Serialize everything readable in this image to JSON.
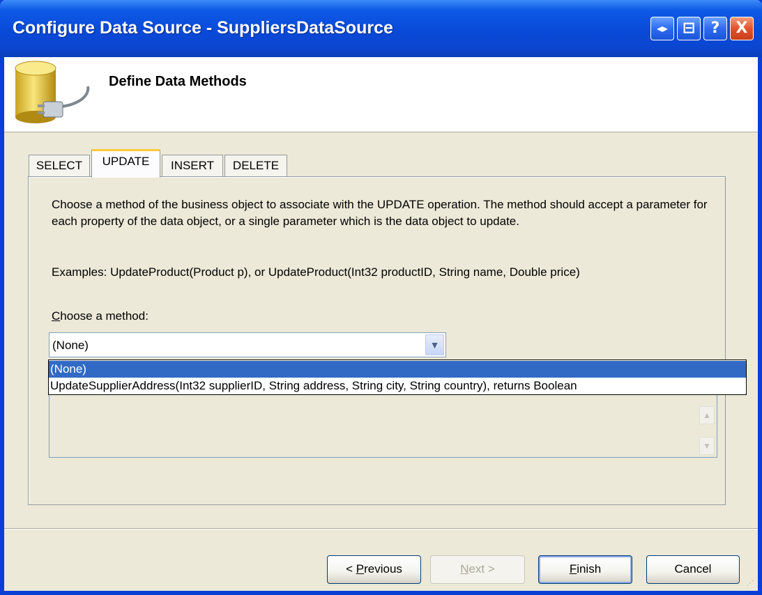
{
  "window": {
    "title": "Configure Data Source - SuppliersDataSource",
    "controls": {
      "restore": "◂▸",
      "minimize": "⊟",
      "help": "?",
      "close": "X"
    }
  },
  "header": {
    "title": "Define Data Methods"
  },
  "tabs": [
    {
      "label": "SELECT",
      "active": false
    },
    {
      "label": "UPDATE",
      "active": true
    },
    {
      "label": "INSERT",
      "active": false
    },
    {
      "label": "DELETE",
      "active": false
    }
  ],
  "panel": {
    "description": "Choose a method of the business object to associate with the UPDATE operation. The method should accept a parameter for each property of the data object, or a single parameter which is the data object to update.",
    "examples": "Examples: UpdateProduct(Product p), or UpdateProduct(Int32 productID, String name, Double price)",
    "choose_label_accesskey": "C",
    "choose_label_rest": "hoose a method:",
    "combo_value": "(None)",
    "dropdown_options": [
      "(None)",
      "UpdateSupplierAddress(Int32 supplierID, String address, String city, String country), returns Boolean"
    ],
    "dropdown_selected_index": 0
  },
  "buttons": {
    "previous_pre": "< ",
    "previous_key": "P",
    "previous_rest": "revious",
    "next_key": "N",
    "next_rest": "ext >",
    "finish_key": "F",
    "finish_rest": "inish",
    "cancel": "Cancel"
  },
  "colors": {
    "titlebar": "#0A49D8",
    "selection": "#316AC5",
    "dialog_bg": "#ECE9D8",
    "active_tab_accent": "#FFC83C"
  },
  "icons": {
    "header": "database-plug-icon",
    "combo_arrow": "chevron-down-icon",
    "scroll_up": "scroll-up-arrow-icon",
    "scroll_down": "scroll-down-arrow-icon"
  }
}
